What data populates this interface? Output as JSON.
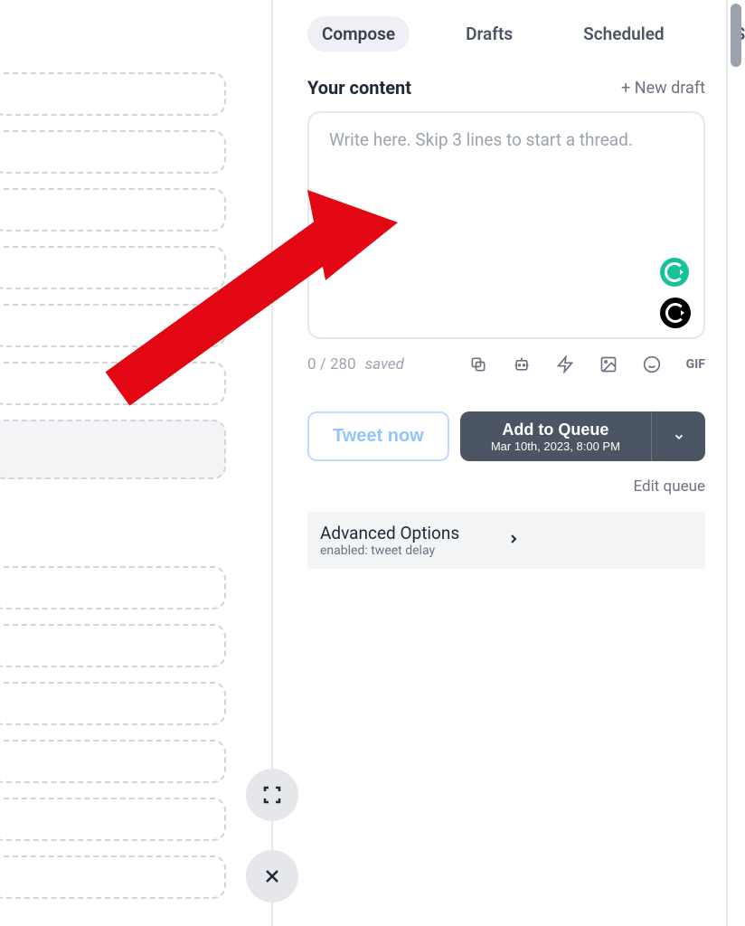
{
  "tabs": {
    "compose": "Compose",
    "drafts": "Drafts",
    "scheduled": "Scheduled",
    "sent": "Sent"
  },
  "header": {
    "title": "Your content",
    "new_draft": "+ New draft"
  },
  "composer": {
    "placeholder": "Write here. Skip 3 lines to start a thread."
  },
  "counter": {
    "count": "0 / 280",
    "saved": "saved",
    "gif": "GIF"
  },
  "buttons": {
    "tweet_now": "Tweet now",
    "add_queue": "Add to Queue",
    "queue_date": "Mar 10th, 2023, 8:00 PM",
    "edit_queue": "Edit queue"
  },
  "advanced": {
    "title": "Advanced Options",
    "subtitle": "enabled: tweet delay"
  }
}
